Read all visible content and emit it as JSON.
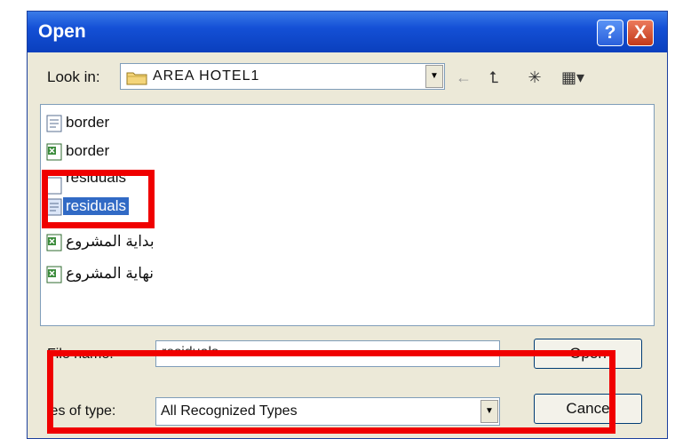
{
  "window": {
    "title": "Open",
    "help_label": "?",
    "close_label": "X"
  },
  "look_in": {
    "label": "Look in:",
    "value": "AREA HOTEL1"
  },
  "toolbar": {
    "back_glyph": "←",
    "up_glyph": "⮤",
    "new_folder_glyph": "✳",
    "views_glyph": "▦▾"
  },
  "files": [
    {
      "name": "border",
      "type": "text"
    },
    {
      "name": "border",
      "type": "excel"
    },
    {
      "name": "residuals",
      "type": "text"
    },
    {
      "name": "residuals",
      "type": "text",
      "selected": true
    },
    {
      "name": "بداية المشروع",
      "type": "excel"
    },
    {
      "name": "نهاية المشروع",
      "type": "excel"
    }
  ],
  "file_name": {
    "label": "File name:",
    "value": "residuals"
  },
  "file_type": {
    "label": "les of type:",
    "value": "All Recognized Types"
  },
  "buttons": {
    "open": "Open",
    "cancel": "Cance"
  },
  "colors": {
    "titlebar": "#1450d6",
    "selection": "#316ac5",
    "annotation": "#f00000",
    "dialog_bg": "#ece9d8"
  }
}
